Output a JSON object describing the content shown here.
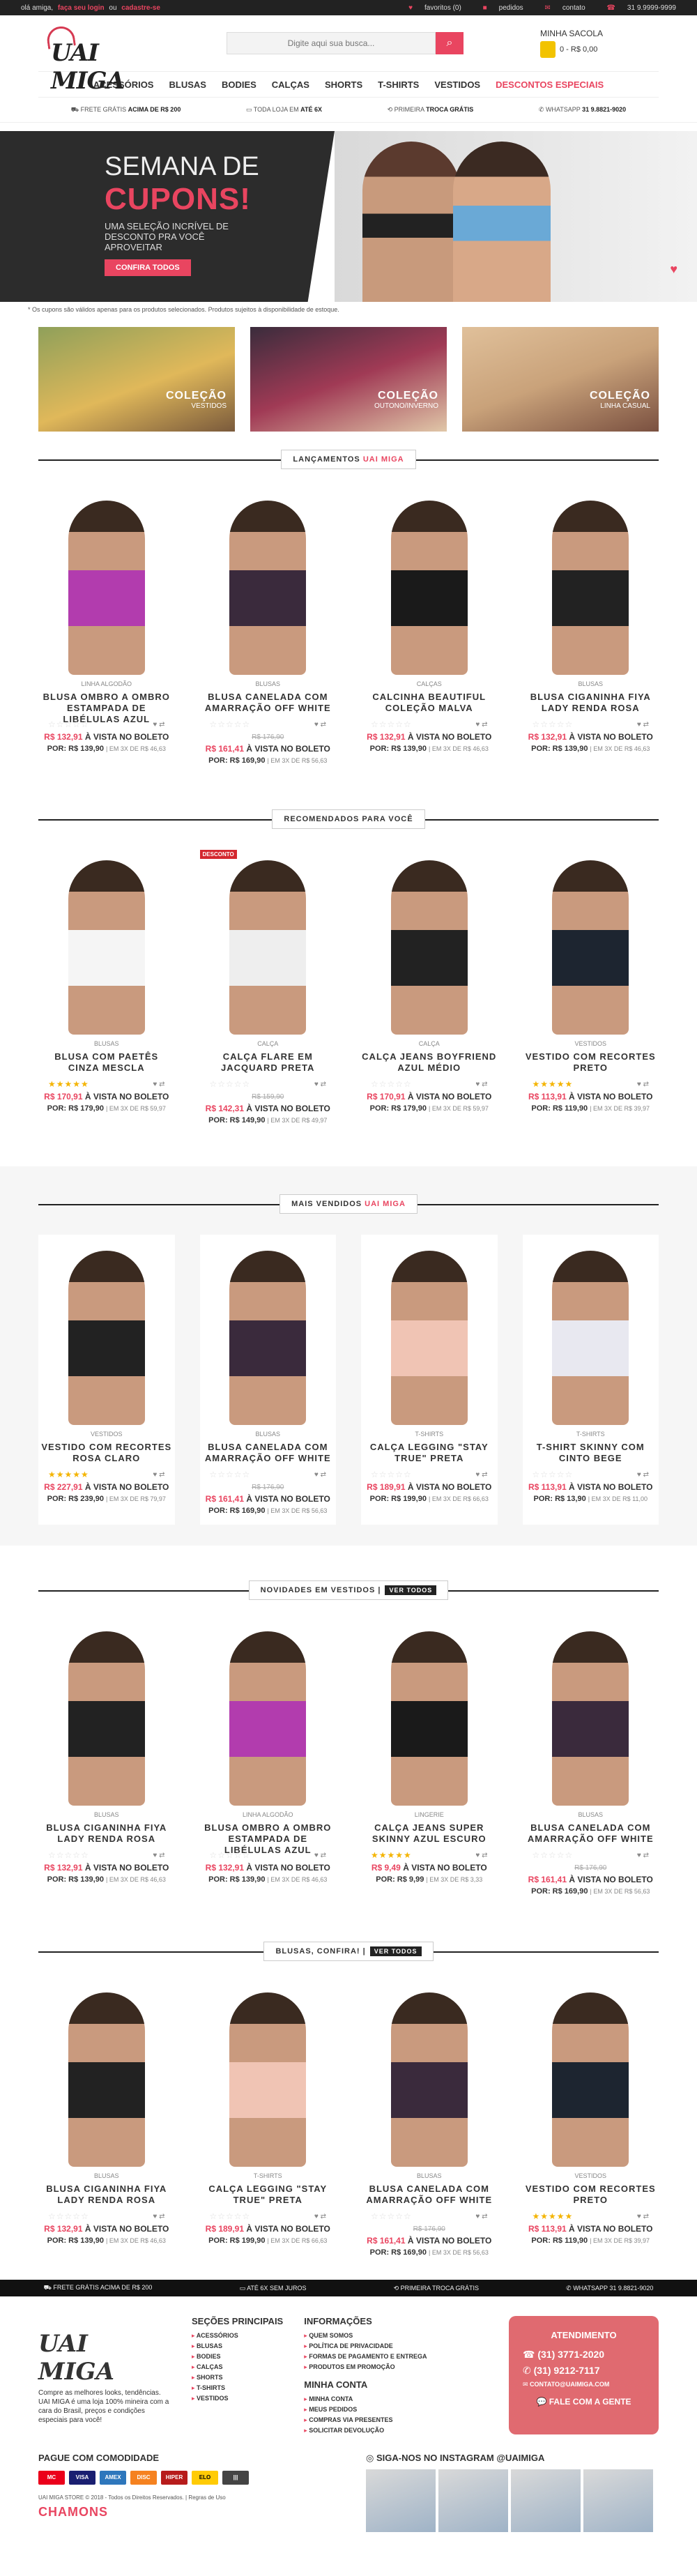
{
  "topbar": {
    "greet_a": "olá amiga,",
    "greet_login": "faça seu login",
    "greet_or": "ou",
    "greet_signup": "cadastre-se",
    "fav": "favoritos (0)",
    "orders": "pedidos",
    "contact": "contato",
    "phone": "31 9.9999-9999"
  },
  "header": {
    "logo_text": "UAI MIGA",
    "search_placeholder": "Digite aqui sua busca...",
    "cart_label": "MINHA SACOLA",
    "cart_amount": "0 - R$ 0,00"
  },
  "nav": [
    "ACESSÓRIOS",
    "BLUSAS",
    "BODIES",
    "CALÇAS",
    "SHORTS",
    "T-SHIRTS",
    "VESTIDOS",
    "DESCONTOS ESPECIAIS"
  ],
  "infostrip": [
    {
      "a": "FRETE GRÁTIS",
      "b": "ACIMA DE R$ 200"
    },
    {
      "a": "TODA LOJA EM",
      "b": "ATÉ 6X"
    },
    {
      "a": "PRIMEIRA",
      "b": "TROCA GRÁTIS"
    },
    {
      "a": "WHATSAPP",
      "b": "31 9.8821-9020"
    }
  ],
  "banner": {
    "t1": "SEMANA DE",
    "t2": "CUPONS!",
    "t3": "UMA SELEÇÃO INCRÍVEL DE DESCONTO PRA VOCÊ APROVEITAR",
    "cta": "CONFIRA TODOS",
    "note": "* Os cupons são válidos apenas para os produtos selecionados. Produtos sujeitos à disponibilidade de estoque."
  },
  "collections": [
    {
      "title": "COLEÇÃO",
      "sub": "VESTIDOS"
    },
    {
      "title": "COLEÇÃO",
      "sub": "OUTONO/INVERNO"
    },
    {
      "title": "COLEÇÃO",
      "sub": "LINHA CASUAL"
    }
  ],
  "sections": {
    "launch": {
      "title": "LANÇAMENTOS",
      "pink": "UAI MIGA"
    },
    "recommended": {
      "title": "RECOMENDADOS PARA VOCÊ"
    },
    "bestsellers": {
      "title": "MAIS VENDIDOS",
      "pink": "UAI MIGA"
    },
    "news": {
      "title": "NOVIDADES EM VESTIDOS |",
      "btn": "VER TODOS"
    },
    "blouses": {
      "title": "BLUSAS, CONFIRA! |",
      "btn": "VER TODOS"
    }
  },
  "products_launch": [
    {
      "cat": "LINHA ALGODÃO",
      "name": "BLUSA OMBRO A OMBRO ESTAMPADA DE LIBÉLULAS AZUL",
      "old": "",
      "pix": "R$ 132,91",
      "inst": "R$ 139,90",
      "x": "EM 3X DE R$ 46,63",
      "color": "#b23cae"
    },
    {
      "cat": "BLUSAS",
      "name": "BLUSA CANELADA COM AMARRAÇÃO OFF WHITE",
      "old": "R$ 176,90",
      "pix": "R$ 161,41",
      "inst": "R$ 169,90",
      "x": "EM 3X DE R$ 56,63",
      "color": "#3a2a3c"
    },
    {
      "cat": "CALÇAS",
      "name": "CALCINHA BEAUTIFUL COLEÇÃO MALVA",
      "old": "",
      "pix": "R$ 132,91",
      "inst": "R$ 139,90",
      "x": "EM 3X DE R$ 46,63",
      "color": "#1a1a1a"
    },
    {
      "cat": "BLUSAS",
      "name": "BLUSA CIGANINHA FIYA LADY RENDA ROSA",
      "old": "",
      "pix": "R$ 132,91",
      "inst": "R$ 139,90",
      "x": "EM 3X DE R$ 46,63",
      "color": "#222"
    }
  ],
  "products_rec": [
    {
      "cat": "BLUSAS",
      "name": "BLUSA COM PAETÊS CINZA MESCLA",
      "old": "",
      "pix": "R$ 170,91",
      "inst": "R$ 179,90",
      "x": "EM 3X DE R$ 59,97",
      "color": "#f5f5f5",
      "stars": "★★★★★",
      "on": true
    },
    {
      "cat": "CALÇA",
      "name": "CALÇA FLARE EM JACQUARD PRETA",
      "old": "R$ 159,90",
      "pix": "R$ 142,31",
      "inst": "R$ 149,90",
      "x": "EM 3X DE R$ 49,97",
      "color": "#eeeeee",
      "discount": "DESCONTO"
    },
    {
      "cat": "CALÇA",
      "name": "CALÇA JEANS BOYFRIEND AZUL MÉDIO",
      "old": "",
      "pix": "R$ 170,91",
      "inst": "R$ 179,90",
      "x": "EM 3X DE R$ 59,97",
      "color": "#222"
    },
    {
      "cat": "VESTIDOS",
      "name": "VESTIDO COM RECORTES PRETO",
      "old": "",
      "pix": "R$ 113,91",
      "inst": "R$ 119,90",
      "x": "EM 3X DE R$ 39,97",
      "color": "#1d2530",
      "stars": "★★★★★",
      "on": true
    }
  ],
  "products_best": [
    {
      "cat": "VESTIDOS",
      "name": "VESTIDO COM RECORTES ROSA CLARO",
      "old": "",
      "pix": "R$ 227,91",
      "inst": "R$ 239,90",
      "x": "EM 3X DE R$ 79,97",
      "color": "#222",
      "stars": "★★★★★",
      "on": true
    },
    {
      "cat": "BLUSAS",
      "name": "BLUSA CANELADA COM AMARRAÇÃO OFF WHITE",
      "old": "R$ 176,90",
      "pix": "R$ 161,41",
      "inst": "R$ 169,90",
      "x": "EM 3X DE R$ 56,63",
      "color": "#3a2a3c"
    },
    {
      "cat": "T-SHIRTS",
      "name": "CALÇA LEGGING \"STAY TRUE\" PRETA",
      "old": "",
      "pix": "R$ 189,91",
      "inst": "R$ 199,90",
      "x": "EM 3X DE R$ 66,63",
      "color": "#f0c4b4"
    },
    {
      "cat": "T-SHIRTS",
      "name": "T-SHIRT SKINNY COM CINTO BEGE",
      "old": "",
      "pix": "R$ 113,91",
      "inst": "R$ 13,90",
      "x": "EM 3X DE R$ 11,00",
      "color": "#e8e8f0"
    }
  ],
  "products_news": [
    {
      "cat": "BLUSAS",
      "name": "BLUSA CIGANINHA FIYA LADY RENDA ROSA",
      "old": "",
      "pix": "R$ 132,91",
      "inst": "R$ 139,90",
      "x": "EM 3X DE R$ 46,63",
      "color": "#222"
    },
    {
      "cat": "LINHA ALGODÃO",
      "name": "BLUSA OMBRO A OMBRO ESTAMPADA DE LIBÉLULAS AZUL",
      "old": "",
      "pix": "R$ 132,91",
      "inst": "R$ 139,90",
      "x": "EM 3X DE R$ 46,63",
      "color": "#b23cae"
    },
    {
      "cat": "LINGERIE",
      "name": "CALÇA JEANS SUPER SKINNY AZUL ESCURO",
      "old": "",
      "pix": "R$ 9,49",
      "inst": "R$ 9,99",
      "x": "EM 3X DE R$ 3,33",
      "color": "#1a1a1a",
      "stars": "★★★★★",
      "on": true
    },
    {
      "cat": "BLUSAS",
      "name": "BLUSA CANELADA COM AMARRAÇÃO OFF WHITE",
      "old": "R$ 176,90",
      "pix": "R$ 161,41",
      "inst": "R$ 169,90",
      "x": "EM 3X DE R$ 56,63",
      "color": "#3a2a3c"
    }
  ],
  "products_blouses": [
    {
      "cat": "BLUSAS",
      "name": "BLUSA CIGANINHA FIYA LADY RENDA ROSA",
      "old": "",
      "pix": "R$ 132,91",
      "inst": "R$ 139,90",
      "x": "EM 3X DE R$ 46,63",
      "color": "#222"
    },
    {
      "cat": "T-SHIRTS",
      "name": "CALÇA LEGGING \"STAY TRUE\" PRETA",
      "old": "",
      "pix": "R$ 189,91",
      "inst": "R$ 199,90",
      "x": "EM 3X DE R$ 66,63",
      "color": "#f0c4b4"
    },
    {
      "cat": "BLUSAS",
      "name": "BLUSA CANELADA COM AMARRAÇÃO OFF WHITE",
      "old": "R$ 176,90",
      "pix": "R$ 161,41",
      "inst": "R$ 169,90",
      "x": "EM 3X DE R$ 56,63",
      "color": "#3a2a3c"
    },
    {
      "cat": "VESTIDOS",
      "name": "VESTIDO COM RECORTES PRETO",
      "old": "",
      "pix": "R$ 113,91",
      "inst": "R$ 119,90",
      "x": "EM 3X DE R$ 39,97",
      "color": "#1d2530",
      "stars": "★★★★★",
      "on": true
    }
  ],
  "pix_suffix": "À VISTA NO BOLETO",
  "inst_prefix": "POR:",
  "footbar": [
    "FRETE GRÁTIS ACIMA DE R$ 200",
    "ATÉ 6X SEM JUROS",
    "PRIMEIRA TROCA GRÁTIS",
    "WHATSAPP 31 9.8821-9020"
  ],
  "footer": {
    "logo": "UAI MIGA",
    "about": "Compre as melhores looks, tendências. UAI MIGA é uma loja 100% mineira com a cara do Brasil, preços e condições especiais para você!",
    "col1_title": "SEÇÕES PRINCIPAIS",
    "col1": [
      "ACESSÓRIOS",
      "BLUSAS",
      "BODIES",
      "CALÇAS",
      "SHORTS",
      "T-SHIRTS",
      "VESTIDOS"
    ],
    "col2_title": "INFORMAÇÕES",
    "col2": [
      "QUEM SOMOS",
      "POLÍTICA DE PRIVACIDADE",
      "FORMAS DE PAGAMENTO E ENTREGA",
      "PRODUTOS EM PROMOÇÃO"
    ],
    "col3_title": "MINHA CONTA",
    "col3": [
      "MINHA CONTA",
      "MEUS PEDIDOS",
      "COMPRAS VIA PRESENTES",
      "SOLICITAR DEVOLUÇÃO"
    ],
    "att_title": "ATENDIMENTO",
    "phone1": "(31) 3771-2020",
    "phone2": "(31) 9212-7117",
    "email": "CONTATO@UAIMIGA.COM",
    "chat": "FALE COM A GENTE",
    "pay_title": "PAGUE COM COMODIDADE",
    "insta_title": "SIGA-NOS NO INSTAGRAM @UAIMIGA",
    "copyright": "UAI MIGA STORE © 2018 - Todos os Direitos Reservados. | Regras de Uso",
    "agency": "CHAMONS"
  }
}
